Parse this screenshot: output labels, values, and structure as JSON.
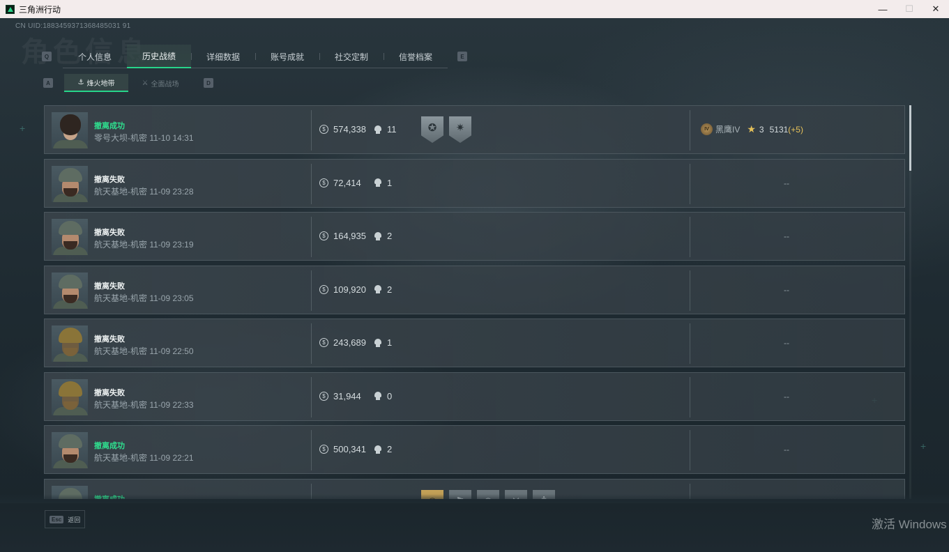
{
  "window": {
    "title": "三角洲行动",
    "controls": [
      "—",
      "☐",
      "✕"
    ]
  },
  "uid": "CN UID:1883459371368485031 91",
  "watermark": "角色信息",
  "tabs": {
    "left_key": "Q",
    "right_key": "E",
    "items": [
      {
        "label": "个人信息",
        "active": false
      },
      {
        "label": "历史战绩",
        "active": true
      },
      {
        "label": "详细数据",
        "active": false
      },
      {
        "label": "账号成就",
        "active": false
      },
      {
        "label": "社交定制",
        "active": false
      },
      {
        "label": "信誉档案",
        "active": false
      }
    ]
  },
  "subtabs": {
    "left_key": "A",
    "right_key": "D",
    "items": [
      {
        "label": "烽火地带",
        "icon": "flame-zone-icon",
        "active": true
      },
      {
        "label": "全面战场",
        "icon": "battlefield-icon",
        "active": false
      }
    ]
  },
  "records": [
    {
      "status": "撤离成功",
      "result": "success",
      "map": "零号大坝-机密 11-10 14:31",
      "value": "574,338",
      "kills": "11",
      "avatar": "female",
      "badges": [
        {
          "icon": "medal-emblem-icon",
          "style": "silver"
        },
        {
          "icon": "medal-star-icon",
          "style": "silver"
        }
      ],
      "rank": {
        "icon_text": "IV",
        "name": "黑鹰IV",
        "stars": "3",
        "score": "5131",
        "delta": "(+5)"
      }
    },
    {
      "status": "撤离失败",
      "result": "fail",
      "map": "航天基地-机密 11-09 23:28",
      "value": "72,414",
      "kills": "1",
      "avatar": "male",
      "badges": [],
      "empty": "--"
    },
    {
      "status": "撤离失败",
      "result": "fail",
      "map": "航天基地-机密 11-09 23:19",
      "value": "164,935",
      "kills": "2",
      "avatar": "male",
      "badges": [],
      "empty": "--"
    },
    {
      "status": "撤离失败",
      "result": "fail",
      "map": "航天基地-机密 11-09 23:05",
      "value": "109,920",
      "kills": "2",
      "avatar": "male",
      "badges": [],
      "empty": "--"
    },
    {
      "status": "撤离失败",
      "result": "fail",
      "map": "航天基地-机密 11-09 22:50",
      "value": "243,689",
      "kills": "1",
      "avatar": "mask",
      "badges": [],
      "empty": "--"
    },
    {
      "status": "撤离失败",
      "result": "fail",
      "map": "航天基地-机密 11-09 22:33",
      "value": "31,944",
      "kills": "0",
      "avatar": "mask",
      "badges": [],
      "empty": "--"
    },
    {
      "status": "撤离成功",
      "result": "success",
      "map": "航天基地-机密 11-09 22:21",
      "value": "500,341",
      "kills": "2",
      "avatar": "male",
      "badges": [],
      "empty": "--"
    },
    {
      "status": "撤离成功",
      "result": "success",
      "map": "",
      "value": "",
      "kills": "",
      "avatar": "male",
      "badges": [
        {
          "icon": "medal-coin-icon",
          "style": "gold"
        },
        {
          "icon": "medal-flag-icon",
          "style": "dark"
        },
        {
          "icon": "medal-target-icon",
          "style": "dark"
        },
        {
          "icon": "medal-cross-icon",
          "style": "dark"
        },
        {
          "icon": "medal-knife-icon",
          "style": "dark"
        }
      ],
      "empty": ""
    }
  ],
  "footer": {
    "esc_key": "Esc",
    "esc_label": "返回",
    "activation": "激活 Windows"
  },
  "colors": {
    "accent": "#27d58a",
    "success": "#2fe08f",
    "gold": "#e6c15a"
  }
}
